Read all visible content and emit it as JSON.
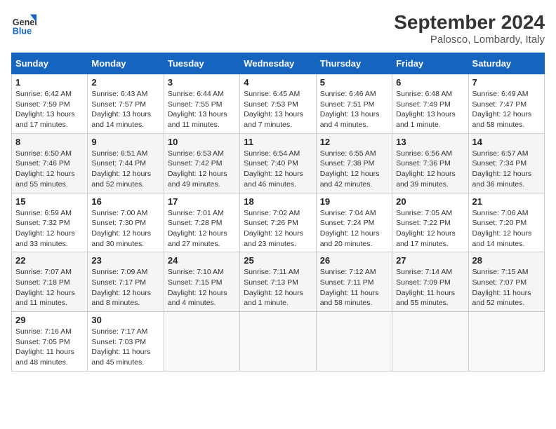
{
  "logo": {
    "line1": "General",
    "line2": "Blue"
  },
  "title": "September 2024",
  "subtitle": "Palosco, Lombardy, Italy",
  "days_of_week": [
    "Sunday",
    "Monday",
    "Tuesday",
    "Wednesday",
    "Thursday",
    "Friday",
    "Saturday"
  ],
  "weeks": [
    [
      {
        "day": 1,
        "sunrise": "6:42 AM",
        "sunset": "7:59 PM",
        "daylight": "13 hours and 17 minutes."
      },
      {
        "day": 2,
        "sunrise": "6:43 AM",
        "sunset": "7:57 PM",
        "daylight": "13 hours and 14 minutes."
      },
      {
        "day": 3,
        "sunrise": "6:44 AM",
        "sunset": "7:55 PM",
        "daylight": "13 hours and 11 minutes."
      },
      {
        "day": 4,
        "sunrise": "6:45 AM",
        "sunset": "7:53 PM",
        "daylight": "13 hours and 7 minutes."
      },
      {
        "day": 5,
        "sunrise": "6:46 AM",
        "sunset": "7:51 PM",
        "daylight": "13 hours and 4 minutes."
      },
      {
        "day": 6,
        "sunrise": "6:48 AM",
        "sunset": "7:49 PM",
        "daylight": "13 hours and 1 minute."
      },
      {
        "day": 7,
        "sunrise": "6:49 AM",
        "sunset": "7:47 PM",
        "daylight": "12 hours and 58 minutes."
      }
    ],
    [
      {
        "day": 8,
        "sunrise": "6:50 AM",
        "sunset": "7:46 PM",
        "daylight": "12 hours and 55 minutes."
      },
      {
        "day": 9,
        "sunrise": "6:51 AM",
        "sunset": "7:44 PM",
        "daylight": "12 hours and 52 minutes."
      },
      {
        "day": 10,
        "sunrise": "6:53 AM",
        "sunset": "7:42 PM",
        "daylight": "12 hours and 49 minutes."
      },
      {
        "day": 11,
        "sunrise": "6:54 AM",
        "sunset": "7:40 PM",
        "daylight": "12 hours and 46 minutes."
      },
      {
        "day": 12,
        "sunrise": "6:55 AM",
        "sunset": "7:38 PM",
        "daylight": "12 hours and 42 minutes."
      },
      {
        "day": 13,
        "sunrise": "6:56 AM",
        "sunset": "7:36 PM",
        "daylight": "12 hours and 39 minutes."
      },
      {
        "day": 14,
        "sunrise": "6:57 AM",
        "sunset": "7:34 PM",
        "daylight": "12 hours and 36 minutes."
      }
    ],
    [
      {
        "day": 15,
        "sunrise": "6:59 AM",
        "sunset": "7:32 PM",
        "daylight": "12 hours and 33 minutes."
      },
      {
        "day": 16,
        "sunrise": "7:00 AM",
        "sunset": "7:30 PM",
        "daylight": "12 hours and 30 minutes."
      },
      {
        "day": 17,
        "sunrise": "7:01 AM",
        "sunset": "7:28 PM",
        "daylight": "12 hours and 27 minutes."
      },
      {
        "day": 18,
        "sunrise": "7:02 AM",
        "sunset": "7:26 PM",
        "daylight": "12 hours and 23 minutes."
      },
      {
        "day": 19,
        "sunrise": "7:04 AM",
        "sunset": "7:24 PM",
        "daylight": "12 hours and 20 minutes."
      },
      {
        "day": 20,
        "sunrise": "7:05 AM",
        "sunset": "7:22 PM",
        "daylight": "12 hours and 17 minutes."
      },
      {
        "day": 21,
        "sunrise": "7:06 AM",
        "sunset": "7:20 PM",
        "daylight": "12 hours and 14 minutes."
      }
    ],
    [
      {
        "day": 22,
        "sunrise": "7:07 AM",
        "sunset": "7:18 PM",
        "daylight": "12 hours and 11 minutes."
      },
      {
        "day": 23,
        "sunrise": "7:09 AM",
        "sunset": "7:17 PM",
        "daylight": "12 hours and 8 minutes."
      },
      {
        "day": 24,
        "sunrise": "7:10 AM",
        "sunset": "7:15 PM",
        "daylight": "12 hours and 4 minutes."
      },
      {
        "day": 25,
        "sunrise": "7:11 AM",
        "sunset": "7:13 PM",
        "daylight": "12 hours and 1 minute."
      },
      {
        "day": 26,
        "sunrise": "7:12 AM",
        "sunset": "7:11 PM",
        "daylight": "11 hours and 58 minutes."
      },
      {
        "day": 27,
        "sunrise": "7:14 AM",
        "sunset": "7:09 PM",
        "daylight": "11 hours and 55 minutes."
      },
      {
        "day": 28,
        "sunrise": "7:15 AM",
        "sunset": "7:07 PM",
        "daylight": "11 hours and 52 minutes."
      }
    ],
    [
      {
        "day": 29,
        "sunrise": "7:16 AM",
        "sunset": "7:05 PM",
        "daylight": "11 hours and 48 minutes."
      },
      {
        "day": 30,
        "sunrise": "7:17 AM",
        "sunset": "7:03 PM",
        "daylight": "11 hours and 45 minutes."
      },
      null,
      null,
      null,
      null,
      null
    ]
  ]
}
